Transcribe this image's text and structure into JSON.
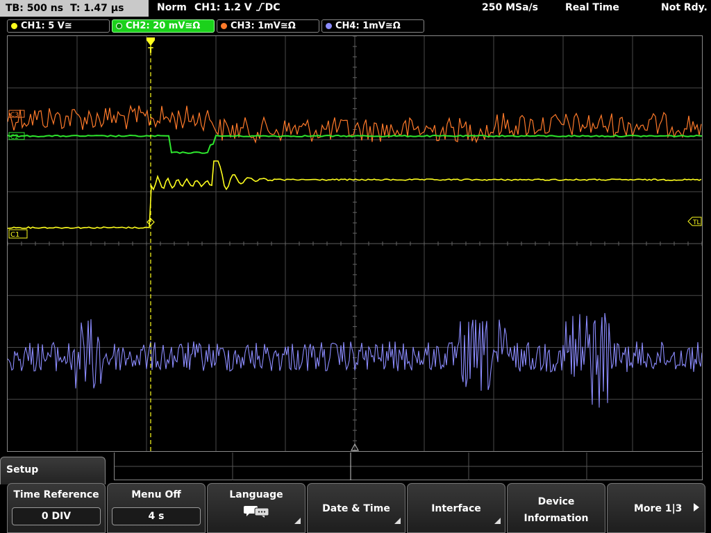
{
  "top": {
    "timebase": "TB: 500 ns",
    "trigger_time": "T: 1.47 µs",
    "mode": "Norm",
    "trigger": "CH1: 1.2 V",
    "trigger_slope_coupling": "DC",
    "sample_rate": "250 MSa/s",
    "acq_mode": "Real Time",
    "status": "Not Rdy."
  },
  "channels": [
    {
      "label": "CH1: 5 V≅",
      "color": "#ffff1e"
    },
    {
      "label": "CH2: 20 mV≅Ω",
      "color": "#2ee82e",
      "active": true
    },
    {
      "label": "CH3: 1mV≅Ω",
      "color": "#ff7a2a"
    },
    {
      "label": "CH4: 1mV≅Ω",
      "color": "#8c8cff"
    }
  ],
  "markers": {
    "trigger_level": "TL",
    "ch1_ref": "C1",
    "ch2_ref": "C2",
    "ch3_ref": "C3",
    "trigger_pos": "T"
  },
  "menu": {
    "title": "Setup",
    "time_reference": {
      "label": "Time Reference",
      "value": "0 DIV"
    },
    "menu_off": {
      "label": "Menu Off",
      "value": "4 s"
    },
    "language": {
      "label": "Language",
      "icon": "speech-bubbles-icon"
    },
    "date_time": {
      "label": "Date & Time"
    },
    "interface": {
      "label": "Interface"
    },
    "device_info": {
      "label": "Device Information"
    },
    "more": {
      "label": "More 1|3"
    }
  },
  "colors": {
    "ch1": "#ffff1e",
    "ch2": "#2ee82e",
    "ch3": "#ff7a2a",
    "ch4": "#8c8cff",
    "grid": "#5a5a5a"
  }
}
